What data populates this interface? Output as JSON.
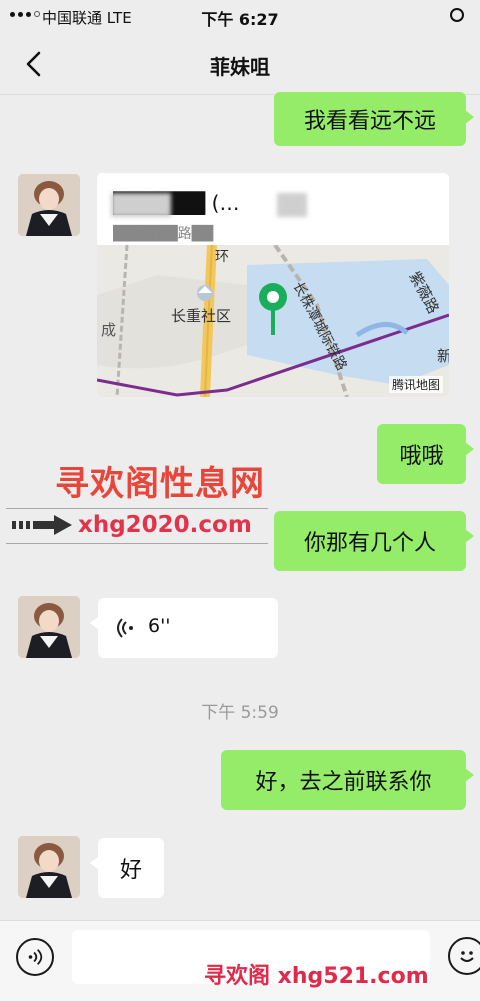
{
  "status_bar": {
    "carrier": "中国联通  LTE",
    "time": "下午 6:27"
  },
  "nav": {
    "title": "菲妹咀"
  },
  "messages": [
    {
      "side": "me",
      "type": "text",
      "text": "我看看远不远"
    },
    {
      "side": "other",
      "type": "location",
      "title": "██████ (…",
      "address": "██████路██",
      "map": {
        "labels": [
          "长重社区",
          "长株潭城际铁路",
          "紫薇路",
          "环",
          "成",
          "新"
        ],
        "credit": "腾讯地图"
      }
    },
    {
      "side": "me",
      "type": "text",
      "text": "哦哦"
    },
    {
      "side": "me",
      "type": "text",
      "text": "你那有几个人"
    },
    {
      "side": "other",
      "type": "voice",
      "duration": "6''"
    },
    {
      "type": "time",
      "text": "下午 5:59"
    },
    {
      "side": "me",
      "type": "text",
      "text": "好，去之前联系你"
    },
    {
      "side": "other",
      "type": "text",
      "text": "好"
    }
  ],
  "watermarks": {
    "center_cn": "寻欢阁性息网",
    "center_url": "xhg2020.com",
    "bottom": "寻欢阁 xhg521.com"
  },
  "input_bar": {
    "placeholder": ""
  }
}
